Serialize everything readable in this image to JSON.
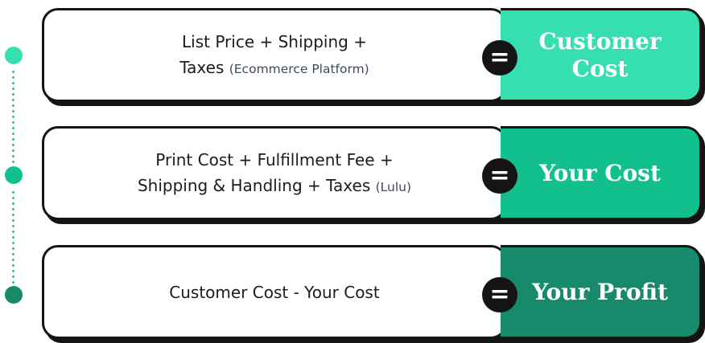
{
  "colors": {
    "row1": "#36dfb0",
    "row2": "#12c08e",
    "row3": "#168a6a",
    "dot1": "#36dfb0",
    "dot2": "#12c08e",
    "dot3": "#168a6a"
  },
  "equal_sign": "=",
  "rows": [
    {
      "line1": "List Price + Shipping +",
      "line2_main": "Taxes",
      "line2_note": "(Ecommerce Platform)",
      "result_line1": "Customer",
      "result_line2": "Cost"
    },
    {
      "line1": "Print Cost + Fulfillment Fee +",
      "line2_main": "Shipping & Handling + Taxes",
      "line2_note": "(Lulu)",
      "result_line1": "Your Cost"
    },
    {
      "line1": "Customer Cost - Your Cost",
      "result_line1": "Your Profit"
    }
  ]
}
